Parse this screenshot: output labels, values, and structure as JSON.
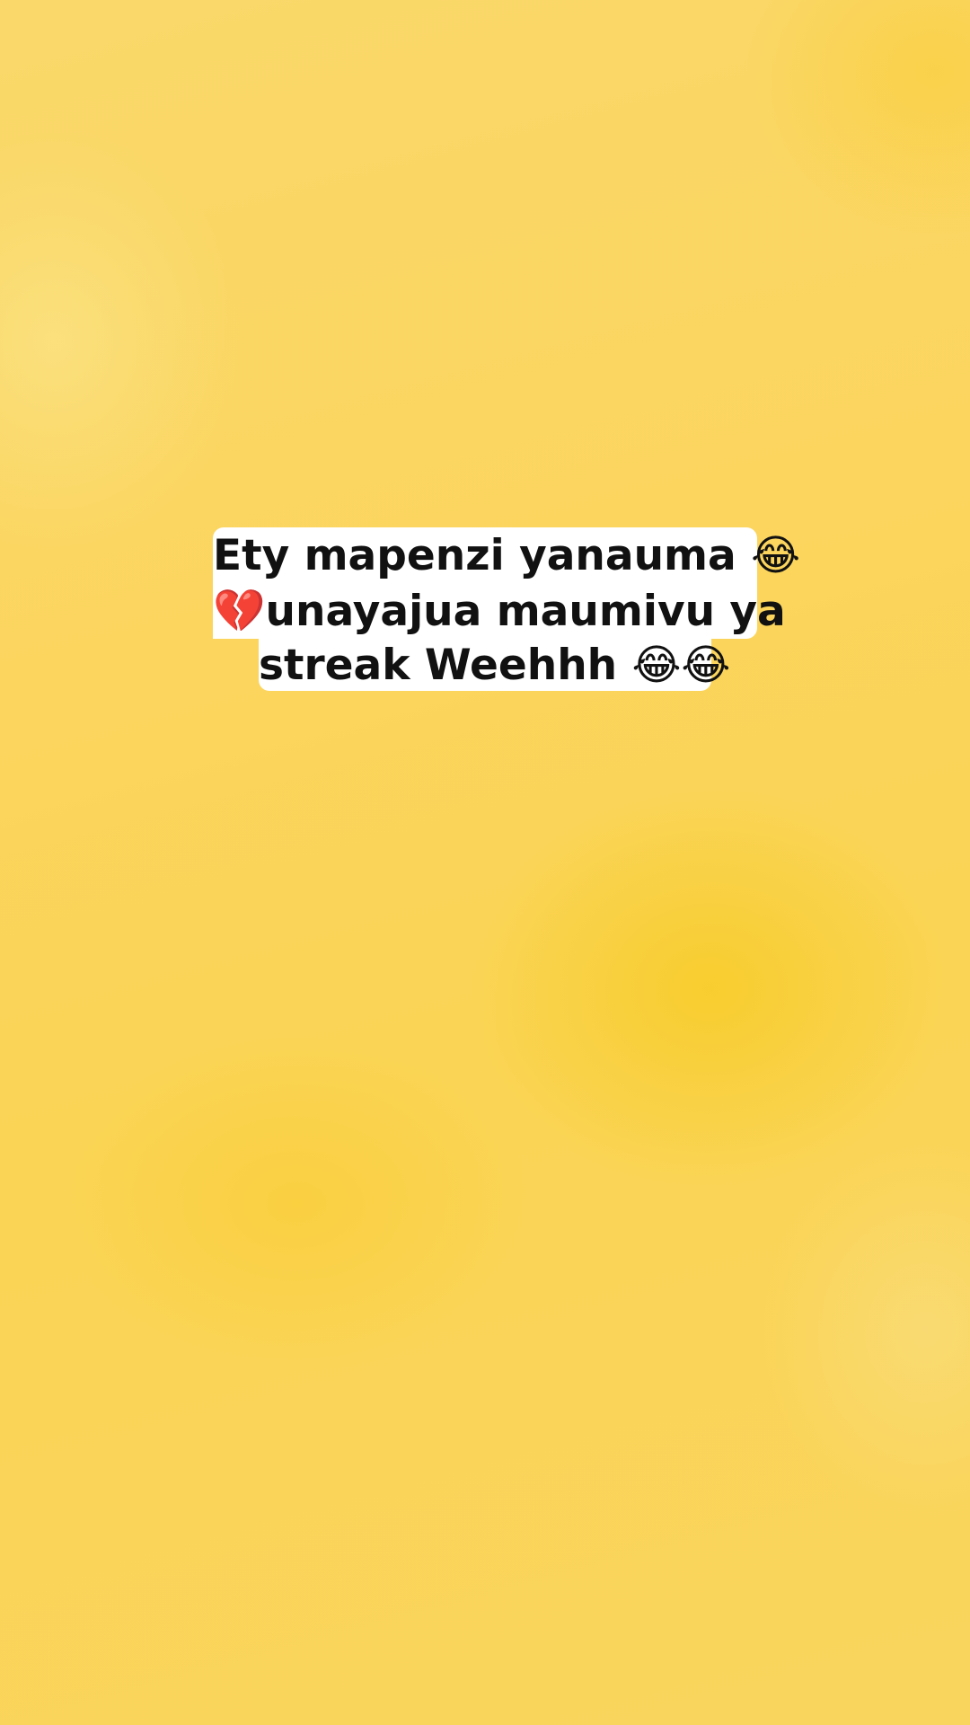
{
  "caption": {
    "lines": [
      "Ety mapenzi yanauma 😂",
      "💔unayajua maumivu ya",
      "streak Weehhh 😂😂"
    ]
  },
  "colors": {
    "background": "#fad55e",
    "caption_bg": "#ffffff",
    "caption_text": "#111111"
  }
}
